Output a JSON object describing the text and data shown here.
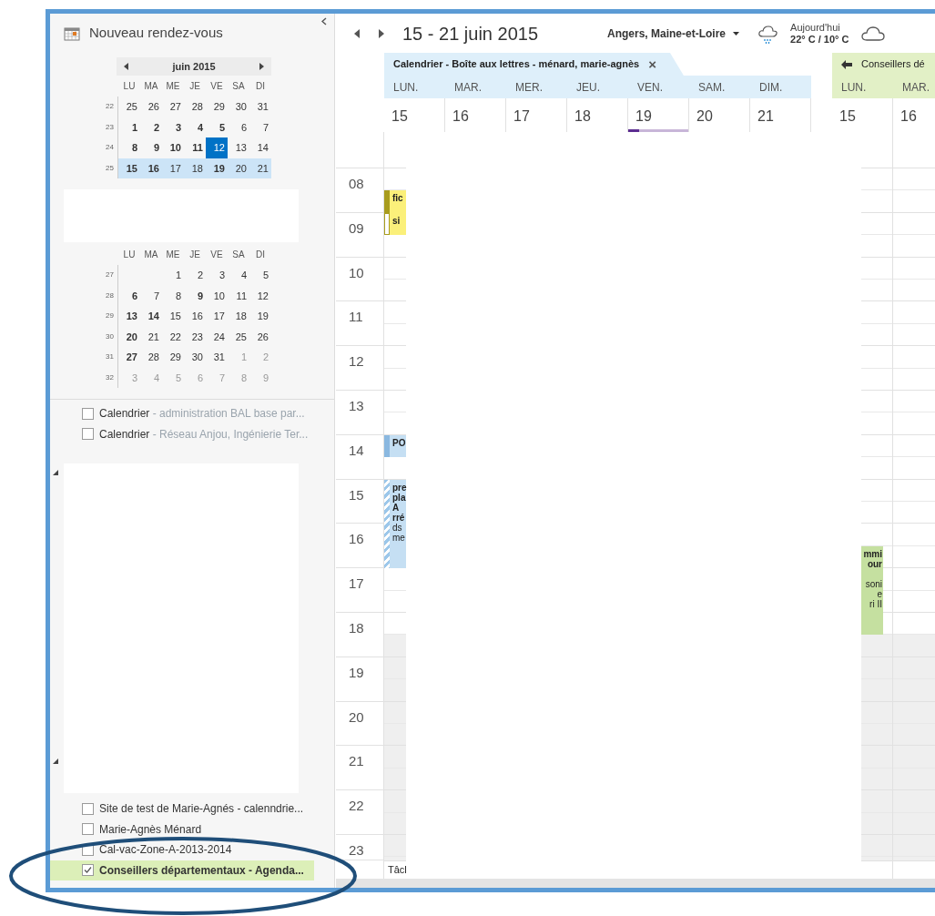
{
  "sidebar": {
    "new_appointment": "Nouveau rendez-vous",
    "months": [
      {
        "title": "juin 2015",
        "weekdays": [
          "LU",
          "MA",
          "ME",
          "JE",
          "VE",
          "SA",
          "DI"
        ],
        "weeks": [
          {
            "number": "22",
            "selected": false,
            "days": [
              {
                "d": "25",
                "bold": false,
                "muted": false,
                "today": false
              },
              {
                "d": "26",
                "bold": false,
                "muted": false,
                "today": false
              },
              {
                "d": "27",
                "bold": false,
                "muted": false,
                "today": false
              },
              {
                "d": "28",
                "bold": false,
                "muted": false,
                "today": false
              },
              {
                "d": "29",
                "bold": false,
                "muted": false,
                "today": false
              },
              {
                "d": "30",
                "bold": false,
                "muted": false,
                "today": false
              },
              {
                "d": "31",
                "bold": false,
                "muted": false,
                "today": false
              }
            ]
          },
          {
            "number": "23",
            "selected": false,
            "days": [
              {
                "d": "1",
                "bold": true,
                "muted": false,
                "today": false
              },
              {
                "d": "2",
                "bold": true,
                "muted": false,
                "today": false
              },
              {
                "d": "3",
                "bold": true,
                "muted": false,
                "today": false
              },
              {
                "d": "4",
                "bold": true,
                "muted": false,
                "today": false
              },
              {
                "d": "5",
                "bold": true,
                "muted": false,
                "today": false
              },
              {
                "d": "6",
                "bold": false,
                "muted": false,
                "today": false
              },
              {
                "d": "7",
                "bold": false,
                "muted": false,
                "today": false
              }
            ]
          },
          {
            "number": "24",
            "selected": false,
            "days": [
              {
                "d": "8",
                "bold": true,
                "muted": false,
                "today": false
              },
              {
                "d": "9",
                "bold": true,
                "muted": false,
                "today": false
              },
              {
                "d": "10",
                "bold": true,
                "muted": false,
                "today": false
              },
              {
                "d": "11",
                "bold": true,
                "muted": false,
                "today": false
              },
              {
                "d": "12",
                "bold": false,
                "muted": false,
                "today": true
              },
              {
                "d": "13",
                "bold": false,
                "muted": false,
                "today": false
              },
              {
                "d": "14",
                "bold": false,
                "muted": false,
                "today": false
              }
            ]
          },
          {
            "number": "25",
            "selected": true,
            "days": [
              {
                "d": "15",
                "bold": true,
                "muted": false,
                "today": false
              },
              {
                "d": "16",
                "bold": true,
                "muted": false,
                "today": false
              },
              {
                "d": "17",
                "bold": false,
                "muted": false,
                "today": false
              },
              {
                "d": "18",
                "bold": false,
                "muted": false,
                "today": false
              },
              {
                "d": "19",
                "bold": true,
                "muted": false,
                "today": false
              },
              {
                "d": "20",
                "bold": false,
                "muted": false,
                "today": false
              },
              {
                "d": "21",
                "bold": false,
                "muted": false,
                "today": false
              }
            ]
          }
        ]
      },
      {
        "weekdays": [
          "LU",
          "MA",
          "ME",
          "JE",
          "VE",
          "SA",
          "DI"
        ],
        "weeks": [
          {
            "number": "27",
            "selected": false,
            "days": [
              {
                "d": "1",
                "bold": false,
                "muted": false,
                "today": false
              },
              {
                "d": "2",
                "bold": false,
                "muted": false,
                "today": false
              },
              {
                "d": "3",
                "bold": false,
                "muted": false,
                "today": false
              },
              {
                "d": "4",
                "bold": false,
                "muted": false,
                "today": false
              },
              {
                "d": "5",
                "bold": false,
                "muted": false,
                "today": false
              }
            ]
          },
          {
            "number": "28",
            "selected": false,
            "days": [
              {
                "d": "6",
                "bold": true,
                "muted": false,
                "today": false
              },
              {
                "d": "7",
                "bold": false,
                "muted": false,
                "today": false
              },
              {
                "d": "8",
                "bold": false,
                "muted": false,
                "today": false
              },
              {
                "d": "9",
                "bold": true,
                "muted": false,
                "today": false
              },
              {
                "d": "10",
                "bold": false,
                "muted": false,
                "today": false
              },
              {
                "d": "11",
                "bold": false,
                "muted": false,
                "today": false
              },
              {
                "d": "12",
                "bold": false,
                "muted": false,
                "today": false
              }
            ]
          },
          {
            "number": "29",
            "selected": false,
            "days": [
              {
                "d": "13",
                "bold": true,
                "muted": false,
                "today": false
              },
              {
                "d": "14",
                "bold": true,
                "muted": false,
                "today": false
              },
              {
                "d": "15",
                "bold": false,
                "muted": false,
                "today": false
              },
              {
                "d": "16",
                "bold": false,
                "muted": false,
                "today": false
              },
              {
                "d": "17",
                "bold": false,
                "muted": false,
                "today": false
              },
              {
                "d": "18",
                "bold": false,
                "muted": false,
                "today": false
              },
              {
                "d": "19",
                "bold": false,
                "muted": false,
                "today": false
              }
            ]
          },
          {
            "number": "30",
            "selected": false,
            "days": [
              {
                "d": "20",
                "bold": true,
                "muted": false,
                "today": false
              },
              {
                "d": "21",
                "bold": false,
                "muted": false,
                "today": false
              },
              {
                "d": "22",
                "bold": false,
                "muted": false,
                "today": false
              },
              {
                "d": "23",
                "bold": false,
                "muted": false,
                "today": false
              },
              {
                "d": "24",
                "bold": false,
                "muted": false,
                "today": false
              },
              {
                "d": "25",
                "bold": false,
                "muted": false,
                "today": false
              },
              {
                "d": "26",
                "bold": false,
                "muted": false,
                "today": false
              }
            ]
          },
          {
            "number": "31",
            "selected": false,
            "days": [
              {
                "d": "27",
                "bold": true,
                "muted": false,
                "today": false
              },
              {
                "d": "28",
                "bold": false,
                "muted": false,
                "today": false
              },
              {
                "d": "29",
                "bold": false,
                "muted": false,
                "today": false
              },
              {
                "d": "30",
                "bold": false,
                "muted": false,
                "today": false
              },
              {
                "d": "31",
                "bold": false,
                "muted": false,
                "today": false
              },
              {
                "d": "1",
                "bold": false,
                "muted": true,
                "today": false
              },
              {
                "d": "2",
                "bold": false,
                "muted": true,
                "today": false
              }
            ]
          },
          {
            "number": "32",
            "selected": false,
            "days": [
              {
                "d": "3",
                "bold": false,
                "muted": true,
                "today": false
              },
              {
                "d": "4",
                "bold": false,
                "muted": true,
                "today": false
              },
              {
                "d": "5",
                "bold": false,
                "muted": true,
                "today": false
              },
              {
                "d": "6",
                "bold": false,
                "muted": true,
                "today": false
              },
              {
                "d": "7",
                "bold": false,
                "muted": true,
                "today": false
              },
              {
                "d": "8",
                "bold": false,
                "muted": true,
                "today": false
              },
              {
                "d": "9",
                "bold": false,
                "muted": true,
                "today": false
              }
            ]
          }
        ]
      }
    ],
    "calendars_top": [
      {
        "name": "Calendrier",
        "detail": " - administration BAL base par...",
        "checked": false,
        "selected": false
      },
      {
        "name": "Calendrier",
        "detail": " - Réseau Anjou, Ingénierie Ter...",
        "checked": false,
        "selected": false
      }
    ],
    "calendars_bottom": [
      {
        "name": "Site de test de Marie-Agnés - calenndrie...",
        "checked": false,
        "selected": false
      },
      {
        "name": "Marie-Agnès Ménard",
        "checked": false,
        "selected": false
      },
      {
        "name": "Cal-vac-Zone-A-2013-2014",
        "checked": false,
        "selected": false
      },
      {
        "name": "Conseillers départementaux - Agenda...",
        "checked": true,
        "selected": true
      }
    ]
  },
  "toolbar": {
    "date_range": "15 - 21 juin 2015",
    "location": "Angers, Maine-et-Loire",
    "weather_label": "Aujourd'hui",
    "temperature": "22° C / 10° C"
  },
  "calendars": [
    {
      "title": "Calendrier - Boîte aux lettres - ménard, marie-agnès",
      "close": "×",
      "color": "#deeffa",
      "days": [
        {
          "name": "LUN.",
          "date": "15",
          "marker": false
        },
        {
          "name": "MAR.",
          "date": "16",
          "marker": false
        },
        {
          "name": "MER.",
          "date": "17",
          "marker": false
        },
        {
          "name": "JEU.",
          "date": "18",
          "marker": false
        },
        {
          "name": "VEN.",
          "date": "19",
          "marker": true
        },
        {
          "name": "SAM.",
          "date": "20",
          "marker": false
        },
        {
          "name": "DIM.",
          "date": "21",
          "marker": false
        }
      ],
      "events": [
        {
          "kind": "busy",
          "color": "#fbf07a",
          "title_lines": [
            "fic"
          ]
        },
        {
          "kind": "free",
          "color": "#fbf07a",
          "title_lines": [
            "si"
          ]
        },
        {
          "kind": "busy",
          "color": "#c5dff3",
          "title_lines": [
            "PO"
          ]
        },
        {
          "kind": "tentative",
          "color": "#c5dff3",
          "title_lines": [
            "pre",
            "pla",
            "A",
            "rré"
          ],
          "body_lines": [
            "ds",
            "me"
          ]
        }
      ]
    },
    {
      "title": "Conseillers dé",
      "color": "#e2f0c6",
      "days": [
        {
          "name": "LUN.",
          "date": "15",
          "marker": false
        },
        {
          "name": "MAR.",
          "date": "16",
          "marker": false
        }
      ],
      "events": [
        {
          "color": "#c5e0a0",
          "title_lines": [
            "mmi",
            "our"
          ],
          "body_lines": [
            "soni",
            "e",
            "ri II"
          ]
        }
      ]
    }
  ],
  "hours": [
    "08",
    "09",
    "10",
    "11",
    "12",
    "13",
    "14",
    "15",
    "16",
    "17",
    "18",
    "19",
    "20",
    "21",
    "22",
    "23"
  ],
  "tasks_label": "Tâcl"
}
